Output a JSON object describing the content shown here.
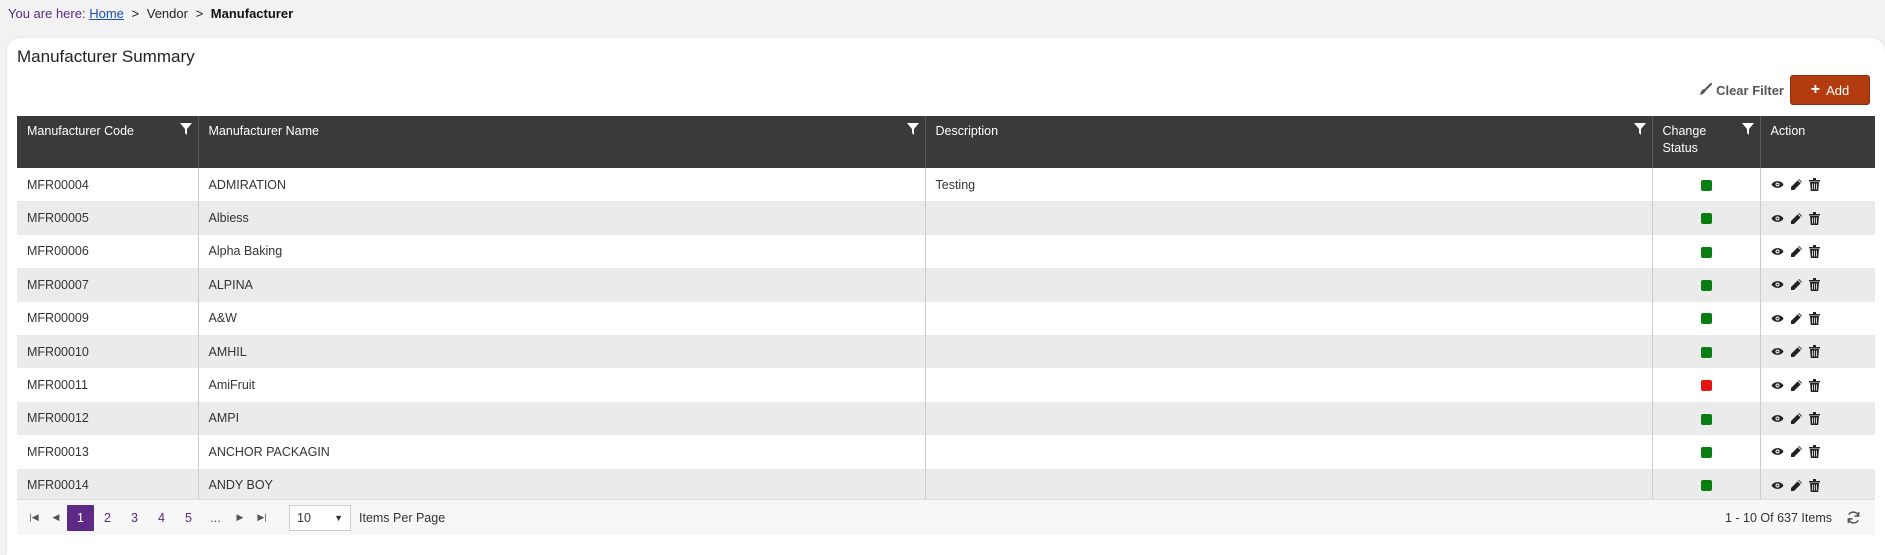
{
  "breadcrumb": {
    "prefix": "You are here:",
    "home": "Home",
    "vendor": "Vendor",
    "current": "Manufacturer",
    "separator": ">"
  },
  "page": {
    "title": "Manufacturer Summary"
  },
  "toolbar": {
    "clear_filter_label": "Clear Filter",
    "add_label": "Add"
  },
  "table": {
    "headers": {
      "code": "Manufacturer Code",
      "name": "Manufacturer Name",
      "description": "Description",
      "status_line1": "Change",
      "status_line2": "Status",
      "action": "Action"
    },
    "rows": [
      {
        "code": "MFR00004",
        "name": "ADMIRATION",
        "description": "Testing",
        "status": "active"
      },
      {
        "code": "MFR00005",
        "name": "Albiess",
        "description": "",
        "status": "active"
      },
      {
        "code": "MFR00006",
        "name": "Alpha Baking",
        "description": "",
        "status": "active"
      },
      {
        "code": "MFR00007",
        "name": "ALPINA",
        "description": "",
        "status": "active"
      },
      {
        "code": "MFR00009",
        "name": "A&W",
        "description": "",
        "status": "active"
      },
      {
        "code": "MFR00010",
        "name": "AMHIL",
        "description": "",
        "status": "active"
      },
      {
        "code": "MFR00011",
        "name": "AmiFruit",
        "description": "",
        "status": "inactive"
      },
      {
        "code": "MFR00012",
        "name": "AMPI",
        "description": "",
        "status": "active"
      },
      {
        "code": "MFR00013",
        "name": "ANCHOR PACKAGIN",
        "description": "",
        "status": "active"
      },
      {
        "code": "MFR00014",
        "name": "ANDY BOY",
        "description": "",
        "status": "active"
      }
    ]
  },
  "pager": {
    "pages": [
      "1",
      "2",
      "3",
      "4",
      "5",
      "..."
    ],
    "current_page": "1",
    "per_page_value": "10",
    "per_page_label": "Items Per Page",
    "info": "1 - 10 Of 637 Items"
  },
  "colors": {
    "header_bg": "#3a3a3a",
    "accent": "#5c2a86",
    "add_button": "#b23c10",
    "status_active": "#0a7d12",
    "status_inactive": "#e21414"
  },
  "icons": {
    "filter": "filter-icon",
    "clear_filter": "brush-icon",
    "add": "plus-icon",
    "view": "eye-icon",
    "edit": "pencil-icon",
    "delete": "trash-icon",
    "refresh": "refresh-icon"
  }
}
